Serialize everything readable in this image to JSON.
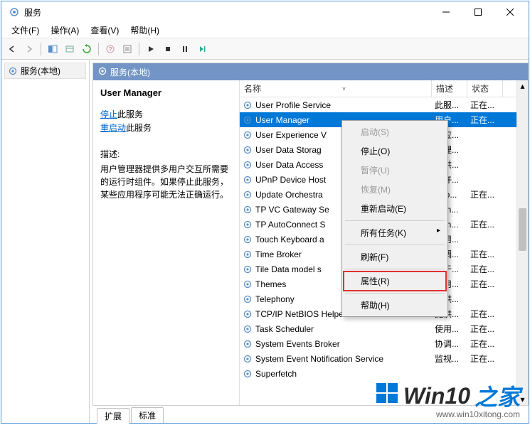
{
  "window": {
    "title": "服务"
  },
  "menubar": {
    "file": "文件(F)",
    "action": "操作(A)",
    "view": "查看(V)",
    "help": "帮助(H)"
  },
  "tree": {
    "root": "服务(本地)"
  },
  "panel": {
    "header": "服务(本地)"
  },
  "detail": {
    "title": "User Manager",
    "stop_link": "停止",
    "stop_suffix": "此服务",
    "restart_link": "重启动",
    "restart_suffix": "此服务",
    "desc_label": "描述:",
    "desc_text": "用户管理器提供多用户交互所需要的运行时组件。如果停止此服务，某些应用程序可能无法正确运行。"
  },
  "columns": {
    "name": "名称",
    "desc": "描述",
    "status": "状态"
  },
  "services": [
    {
      "name": "User Profile Service",
      "desc": "此服...",
      "status": "正在..."
    },
    {
      "name": "User Manager",
      "desc": "用户...",
      "status": "正在...",
      "selected": true
    },
    {
      "name": "User Experience V",
      "desc": "为应...",
      "status": ""
    },
    {
      "name": "User Data Storag",
      "desc": "处理...",
      "status": ""
    },
    {
      "name": "User Data Access",
      "desc": "提供...",
      "status": ""
    },
    {
      "name": "UPnP Device Host",
      "desc": "允许...",
      "status": ""
    },
    {
      "name": "Update Orchestra",
      "desc": "Uso...",
      "status": "正在..."
    },
    {
      "name": "TP VC Gateway Se",
      "desc": "Thin...",
      "status": ""
    },
    {
      "name": "TP AutoConnect S",
      "desc": "Thin...",
      "status": "正在..."
    },
    {
      "name": "Touch Keyboard a",
      "desc": "启用...",
      "status": ""
    },
    {
      "name": "Time Broker",
      "desc": "协调...",
      "status": "正在..."
    },
    {
      "name": "Tile Data model s",
      "desc": "用于...",
      "status": "正在..."
    },
    {
      "name": "Themes",
      "desc": "为用...",
      "status": "正在..."
    },
    {
      "name": "Telephony",
      "desc": "提供...",
      "status": ""
    },
    {
      "name": "TCP/IP NetBIOS Helper",
      "desc": "提供...",
      "status": "正在..."
    },
    {
      "name": "Task Scheduler",
      "desc": "使用...",
      "status": "正在..."
    },
    {
      "name": "System Events Broker",
      "desc": "协调...",
      "status": "正在..."
    },
    {
      "name": "System Event Notification Service",
      "desc": "监视...",
      "status": "正在..."
    },
    {
      "name": "Superfetch",
      "desc": "",
      "status": ""
    }
  ],
  "context_menu": {
    "start": "启动(S)",
    "stop": "停止(O)",
    "pause": "暂停(U)",
    "resume": "恢复(M)",
    "restart": "重新启动(E)",
    "all_tasks": "所有任务(K)",
    "refresh": "刷新(F)",
    "properties": "属性(R)",
    "help": "帮助(H)"
  },
  "tabs": {
    "extended": "扩展",
    "standard": "标准"
  },
  "watermark": {
    "brand_a": "Win10",
    "brand_b": "之家",
    "url": "www.win10xitong.com"
  }
}
